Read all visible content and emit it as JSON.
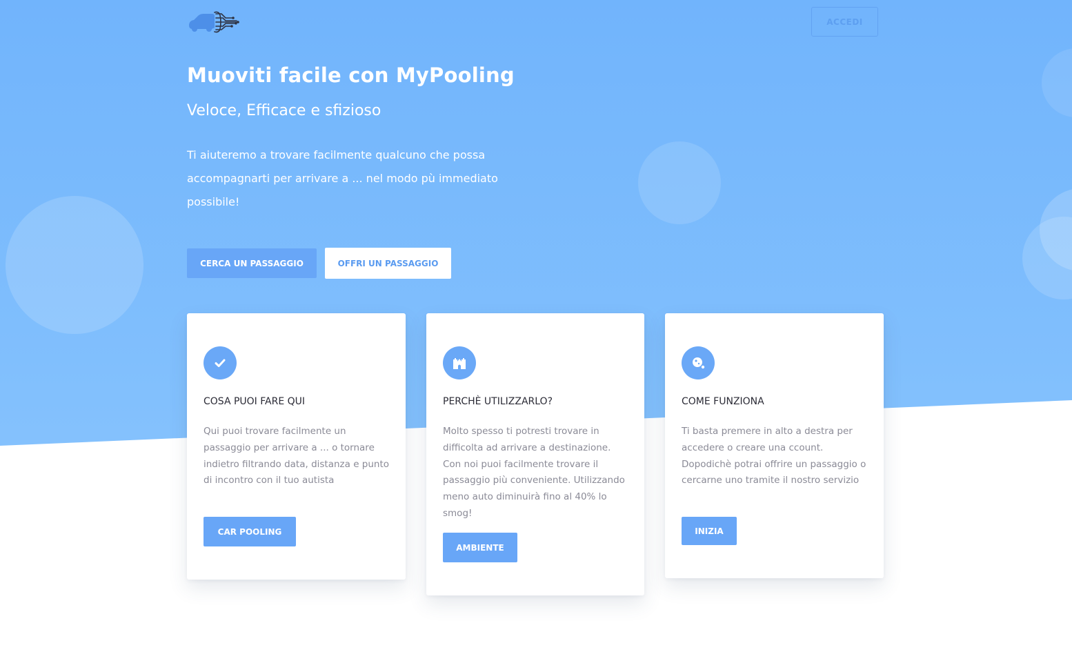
{
  "header": {
    "logo_icon": "car-circuit-logo-icon",
    "login_label": "ACCEDI"
  },
  "hero": {
    "title": "Muoviti facile con MyPooling",
    "subtitle": "Veloce, Efficace e sfizioso",
    "text": "Ti aiuteremo a trovare facilmente qualcuno che possa accompagnarti per arrivare a ... nel modo pù immediato possibile!",
    "search_button": "CERCA UN PASSAGGIO",
    "offer_button": "OFFRI UN PASSAGGIO"
  },
  "cards": [
    {
      "icon": "check-icon",
      "title": "COSA PUOI FARE QUI",
      "text": "Qui puoi trovare facilmente un passaggio per arrivare a ... o tornare indietro filtrando data, distanza e punto di incontro con il tuo autista",
      "button": "CAR POOLING"
    },
    {
      "icon": "castle-icon",
      "title": "PERCHÈ UTILIZZARLO?",
      "text": "Molto spesso ti potresti trovare in difficolta ad arrivare a destinazione. Con noi puoi facilmente trovare il passaggio più conveniente. Utilizzando meno auto diminuirà fino al 40% lo smog!",
      "button": "AMBIENTE"
    },
    {
      "icon": "planet-icon",
      "title": "COME FUNZIONA",
      "text": "Ti basta premere in alto a destra per accedere o creare una ccount. Dopodichè potrai offrire un passaggio o cercarne uno tramite il nostro servizio",
      "button": "INIZIA"
    }
  ],
  "colors": {
    "hero_gradient_top": "#71b4fc",
    "hero_gradient_bottom": "#8fc7fd",
    "accent": "#68a6f7",
    "card_text": "#8a8a96",
    "card_title": "#2b2b36"
  }
}
